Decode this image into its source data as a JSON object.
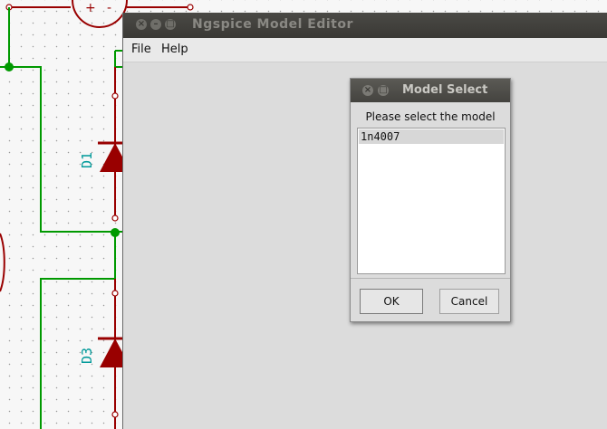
{
  "schematic": {
    "labels": [
      "D1",
      "D3"
    ],
    "pin_labels": [
      "+",
      "-"
    ],
    "colors": {
      "wire": "#009900",
      "component": "#990000",
      "label": "#009999"
    }
  },
  "window": {
    "title": "Ngspice Model Editor",
    "close_icon": "×",
    "min_icon": "–",
    "max_icon": "□"
  },
  "menubar": {
    "file": "File",
    "help": "Help"
  },
  "dialog": {
    "title": "Model Select",
    "prompt": "Please select the model",
    "items": [
      "1n4007"
    ],
    "ok": "OK",
    "cancel": "Cancel"
  }
}
